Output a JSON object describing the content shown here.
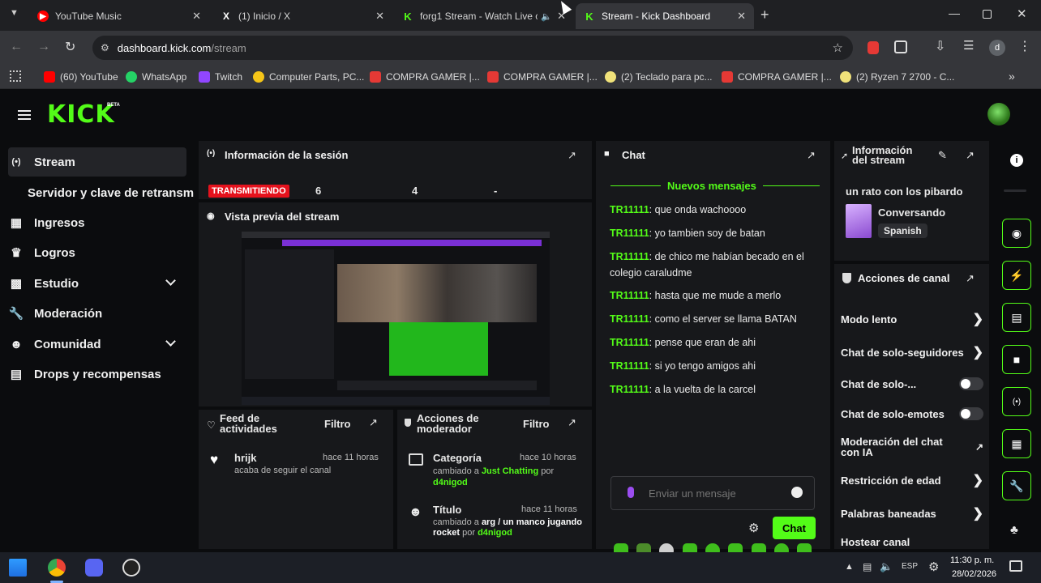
{
  "browser": {
    "tabs": [
      {
        "title": "YouTube Music",
        "icon": "youtube-music-icon",
        "color": "#ff0000"
      },
      {
        "title": "(1) Inicio / X",
        "icon": "x-icon",
        "color": "#ffffff"
      },
      {
        "title": "forg1 Stream - Watch Live c",
        "icon": "kick-icon",
        "color": "#53fc18"
      },
      {
        "title": "Stream - Kick Dashboard",
        "icon": "kick-icon",
        "color": "#53fc18"
      }
    ],
    "url_host": "dashboard.kick.com",
    "url_path": "/stream",
    "profile_initial": "d",
    "bookmarks": [
      {
        "label": "(60) YouTube",
        "color": "#ff0000"
      },
      {
        "label": "WhatsApp",
        "color": "#25d366"
      },
      {
        "label": "Twitch",
        "color": "#9146ff"
      },
      {
        "label": "Computer Parts, PC...",
        "color": "#f5c518"
      },
      {
        "label": "COMPRA GAMER |...",
        "color": "#e53935"
      },
      {
        "label": "COMPRA GAMER |...",
        "color": "#e53935"
      },
      {
        "label": "(2) Teclado para pc...",
        "color": "#f0e27a"
      },
      {
        "label": "COMPRA GAMER |...",
        "color": "#e53935"
      },
      {
        "label": "(2) Ryzen 7 2700 - C...",
        "color": "#f0e27a"
      }
    ]
  },
  "kick": {
    "logo": "KICK",
    "logo_badge": "BETA",
    "accent": "#53fc18",
    "nav": [
      {
        "label": "Stream",
        "icon": "broadcast-icon"
      },
      {
        "label": "Servidor y clave de retransm",
        "icon": ""
      },
      {
        "label": "Ingresos",
        "icon": "chart-icon"
      },
      {
        "label": "Logros",
        "icon": "trophy-icon"
      },
      {
        "label": "Estudio",
        "icon": "studio-icon"
      },
      {
        "label": "Moderación",
        "icon": "wrench-icon"
      },
      {
        "label": "Comunidad",
        "icon": "people-icon"
      },
      {
        "label": "Drops y recompensas",
        "icon": "gift-icon"
      }
    ],
    "session": {
      "title": "Información de la sesión",
      "status": "TRANSMITIENDO",
      "stat1": "6",
      "stat2": "4",
      "stat3": "-"
    },
    "preview_title": "Vista previa del stream",
    "activity": {
      "title_line1": "Feed de",
      "title_line2": "actividades",
      "filter": "Filtro",
      "user": "hrijk",
      "time": "hace 11 horas",
      "desc": "acaba de seguir el canal"
    },
    "mod": {
      "title_line1": "Acciones de",
      "title_line2": "moderador",
      "filter": "Filtro",
      "item1_title": "Categoría",
      "item1_time": "hace 10 horas",
      "item1_pre": "cambiado a",
      "item1_val": "Just Chatting",
      "item1_by": "por",
      "item1_user": "d4nigod",
      "item2_title": "Título",
      "item2_time": "hace 11 horas",
      "item2_pre": "cambiado a",
      "item2_val": "arg / un manco jugando rocket",
      "item2_by": "por",
      "item2_user": "d4nigod"
    },
    "chat": {
      "title": "Chat",
      "new_messages": "Nuevos mensajes",
      "messages": [
        {
          "user": "TR11111",
          "text": ": que onda wachoooo"
        },
        {
          "user": "TR11111",
          "text": ": yo tambien soy de batan"
        },
        {
          "user": "TR11111",
          "text": ": de chico me habían becado en el colegio caraludme"
        },
        {
          "user": "TR11111",
          "text": ": hasta que me mude a merlo"
        },
        {
          "user": "TR11111",
          "text": ": como el server se llama BATAN"
        },
        {
          "user": "TR11111",
          "text": ": pense que eran de ahi"
        },
        {
          "user": "TR11111",
          "text": ": si yo tengo amigos ahi"
        },
        {
          "user": "TR11111",
          "text": ": a la vuelta de la carcel"
        }
      ],
      "input_placeholder": "Enviar un mensaje",
      "send_label": "Chat"
    },
    "stream_info": {
      "title_line1": "Información",
      "title_line2": "del stream",
      "stream_title": "un rato con los pibardo",
      "category": "Conversando",
      "language": "Spanish"
    },
    "channel_actions": {
      "title": "Acciones de canal",
      "items": [
        {
          "label": "Modo lento",
          "control": "chevron"
        },
        {
          "label": "Chat de solo-seguidores",
          "control": "chevron"
        },
        {
          "label": "Chat de solo-...",
          "control": "toggle"
        },
        {
          "label": "Chat de solo-emotes",
          "control": "toggle"
        },
        {
          "label": "Moderación del chat con IA",
          "control": "external"
        },
        {
          "label": "Restricción de edad",
          "control": "chevron"
        },
        {
          "label": "Palabras baneadas",
          "control": "chevron"
        },
        {
          "label": "Hostear canal",
          "control": "none"
        }
      ]
    }
  },
  "taskbar": {
    "lang": "ESP",
    "time": "11:30 p. m.",
    "date": "28/02/2026"
  }
}
